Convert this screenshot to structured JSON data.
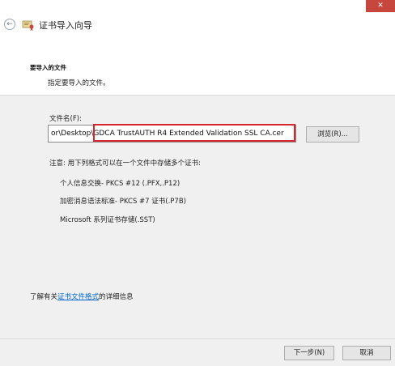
{
  "window": {
    "title": "证书导入向导",
    "close_glyph": "✕"
  },
  "nav": {
    "back_glyph": "←"
  },
  "header": {
    "section_title": "要导入的文件",
    "section_subtitle": "指定要导入的文件。"
  },
  "file": {
    "label": "文件名(F):",
    "path_value": "or\\Desktop\\GDCA TrustAUTH R4 Extended Validation SSL CA.cer",
    "browse_label": "浏览(R)..."
  },
  "note": "注意: 用下列格式可以在一个文件中存储多个证书:",
  "formats": [
    "个人信息交换- PKCS #12 (.PFX,.P12)",
    "加密消息语法标准- PKCS #7 证书(.P7B)",
    "Microsoft 系列证书存储(.SST)"
  ],
  "learn_more": {
    "prefix": "了解有关",
    "link": "证书文件格式",
    "suffix": "的详细信息"
  },
  "footer": {
    "next_label": "下一步(N)",
    "cancel_label": "取消"
  },
  "icons": {
    "back": "back-arrow-icon",
    "wizard": "certificate-wizard-icon",
    "close": "close-icon"
  },
  "colors": {
    "highlight": "#d8262c",
    "link": "#0066cc",
    "close_bg": "#c7463d"
  }
}
